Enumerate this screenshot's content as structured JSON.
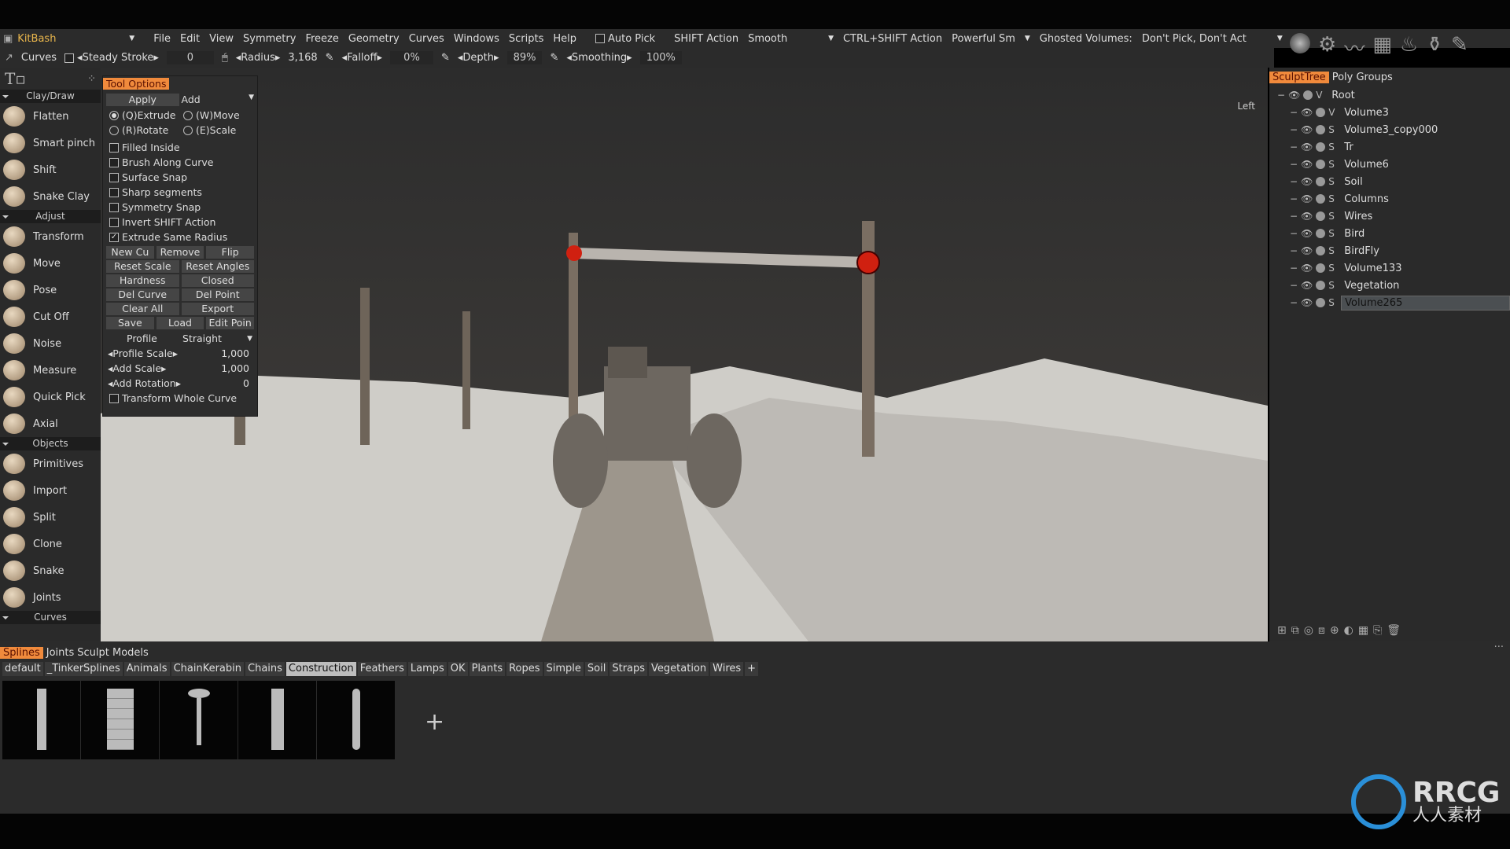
{
  "app": {
    "preset": "KitBash"
  },
  "menu": [
    "File",
    "Edit",
    "View",
    "Symmetry",
    "Freeze",
    "Geometry",
    "Curves",
    "Windows",
    "Scripts",
    "Help"
  ],
  "menu_options": {
    "auto_pick": "Auto Pick",
    "shift_action": "SHIFT Action",
    "shift_value": "Smooth",
    "ctrl_shift": "CTRL+SHIFT Action",
    "ctrl_shift_value": "Powerful Sm",
    "ghosted": "Ghosted Volumes:",
    "ghosted_value": "Don't Pick, Don't Act"
  },
  "toolbar": {
    "tool": "Curves",
    "steady_stroke": "Steady Stroke",
    "steady_value": "0",
    "radius": "Radius",
    "radius_value": "3,168",
    "falloff": "Falloff",
    "falloff_value": "0%",
    "depth": "Depth",
    "depth_value": "89%",
    "smoothing": "Smoothing",
    "smoothing_value": "100%"
  },
  "left_panel": {
    "sections": [
      {
        "title": "Clay/Draw",
        "items": [
          "Flatten",
          "Smart pinch",
          "Shift",
          "Snake Clay"
        ]
      },
      {
        "title": "Adjust",
        "items": [
          "Transform",
          "Move",
          "Pose",
          "Cut Off",
          "Noise",
          "Measure",
          "Quick Pick",
          "Axial"
        ]
      },
      {
        "title": "Objects",
        "items": [
          "Primitives",
          "Import",
          "Split",
          "Clone",
          "Snake",
          "Joints"
        ]
      },
      {
        "title": "Curves",
        "items": []
      }
    ]
  },
  "tool_options": {
    "title": "Tool Options",
    "apply": "Apply",
    "mode": "Add",
    "radios": [
      {
        "label": "(Q)Extrude",
        "on": true
      },
      {
        "label": "(W)Move",
        "on": false
      },
      {
        "label": "(R)Rotate",
        "on": false
      },
      {
        "label": "(E)Scale",
        "on": false
      }
    ],
    "checks": [
      {
        "label": "Filled Inside",
        "on": false
      },
      {
        "label": "Brush Along Curve",
        "on": false
      },
      {
        "label": "Surface Snap",
        "on": false
      },
      {
        "label": "Sharp segments",
        "on": false
      },
      {
        "label": "Symmetry Snap",
        "on": false
      },
      {
        "label": "Invert SHIFT Action",
        "on": false
      },
      {
        "label": "Extrude Same Radius",
        "on": true
      }
    ],
    "buttons": [
      [
        "New Cu",
        "Remove",
        "Flip"
      ],
      [
        "Reset Scale",
        "Reset Angles"
      ],
      [
        "Hardness",
        "Closed"
      ],
      [
        "Del Curve",
        "Del Point"
      ],
      [
        "Clear All",
        "Export"
      ],
      [
        "Save",
        "Load",
        "Edit Poin"
      ]
    ],
    "profile_label": "Profile",
    "profile_value": "Straight",
    "params": [
      {
        "label": "Profile Scale",
        "value": "1,000"
      },
      {
        "label": "Add Scale",
        "value": "1,000"
      },
      {
        "label": "Add Rotation",
        "value": "0"
      }
    ],
    "transform_whole": "Transform Whole Curve"
  },
  "viewport": {
    "view_label": "Left"
  },
  "right_panel": {
    "tabs": [
      "SculptTree",
      "Poly Groups"
    ],
    "tree": [
      {
        "type": "V",
        "name": "Root",
        "level": 0
      },
      {
        "type": "V",
        "name": "Volume3",
        "level": 1
      },
      {
        "type": "S",
        "name": "Volume3_copy000",
        "level": 1
      },
      {
        "type": "S",
        "name": "Tr",
        "level": 1
      },
      {
        "type": "S",
        "name": "Volume6",
        "level": 1
      },
      {
        "type": "S",
        "name": "Soil",
        "level": 1
      },
      {
        "type": "S",
        "name": "Columns",
        "level": 1
      },
      {
        "type": "S",
        "name": "Wires",
        "level": 1
      },
      {
        "type": "S",
        "name": "Bird",
        "level": 1
      },
      {
        "type": "S",
        "name": "BirdFly",
        "level": 1
      },
      {
        "type": "S",
        "name": "Volume133",
        "level": 1
      },
      {
        "type": "S",
        "name": "Vegetation",
        "level": 1
      },
      {
        "type": "S",
        "name": "Volume265",
        "level": 1,
        "selected": true
      }
    ]
  },
  "bottom": {
    "tabs": [
      "Splines",
      "Joints",
      "Sculpt Models"
    ],
    "active_tab": "Splines",
    "categories": [
      "default",
      "_TinkerSplines",
      "Animals",
      "ChainKerabin",
      "Chains",
      "Construction",
      "Feathers",
      "Lamps",
      "OK",
      "Plants",
      "Ropes",
      "Simple",
      "Soil",
      "Straps",
      "Vegetation",
      "Wires"
    ],
    "active_category": "Construction",
    "add": "+"
  },
  "watermark": {
    "text": "RRCG",
    "sub": "人人素材"
  },
  "colors": {
    "accent": "#f08a3c",
    "panel": "#2b2b2b"
  }
}
